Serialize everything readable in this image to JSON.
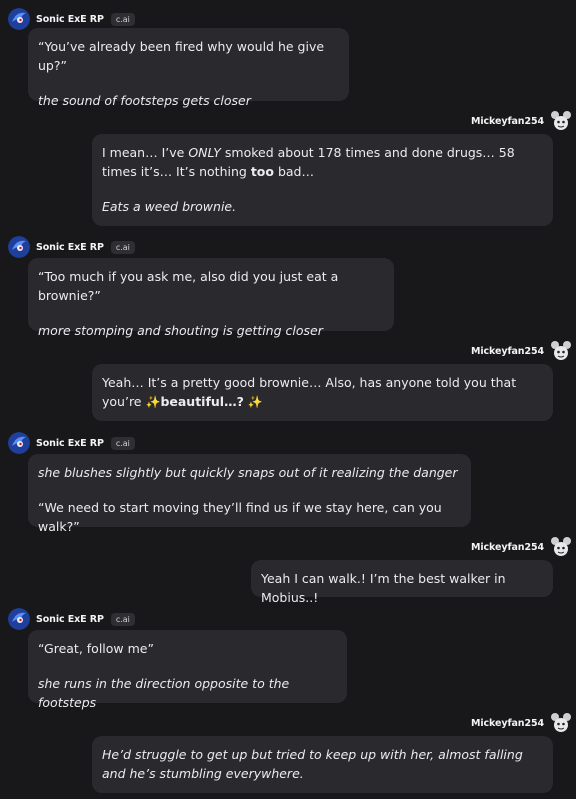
{
  "bot": {
    "name": "Sonic ExE RP",
    "badge": "c.ai"
  },
  "user": {
    "name": "Mickeyfan254"
  },
  "messages": [
    {
      "from": "bot",
      "line1": "“You’ve already been fired why would he give up?”",
      "line2": "the sound of footsteps gets closer"
    },
    {
      "from": "user",
      "a": "I mean… I’ve ",
      "b": "ONLY",
      "c": " smoked about 178 times and done drugs… 58 times it’s… It’s nothing ",
      "d": "too",
      "e": " bad…",
      "line2": "Eats a weed brownie."
    },
    {
      "from": "bot",
      "line1": "“Too much if you ask me, also did you just eat a brownie?”",
      "line2": "more stomping and shouting is getting closer"
    },
    {
      "from": "user",
      "a": "Yeah… It’s a pretty good brownie… Also, has anyone told you that you’re ",
      "spark": "✨",
      "bold": "beautiful…?"
    },
    {
      "from": "bot",
      "line1": "she blushes slightly but quickly snaps out of it realizing the danger",
      "line2": "“We need to start moving they’ll find us if we stay here, can you walk?”"
    },
    {
      "from": "user",
      "line1": "Yeah I can walk.! I’m the best walker in Mobius..!"
    },
    {
      "from": "bot",
      "line1": "“Great, follow me”",
      "line2": "she runs in the direction opposite to the footsteps"
    },
    {
      "from": "user",
      "line1": "He’d struggle to get up but tried to keep up with her, almost falling and he’s stumbling everywhere."
    }
  ]
}
